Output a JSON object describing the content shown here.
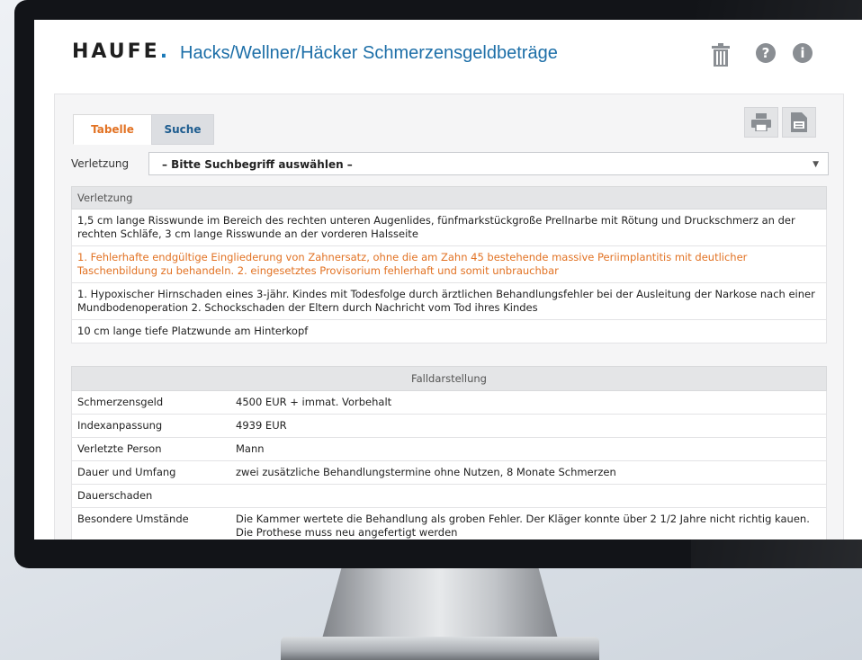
{
  "app": {
    "logo": "HAUFE",
    "logo_dot": ".",
    "title": "Hacks/Wellner/Häcker Schmerzensgeldbeträge",
    "header_icons": [
      "trash-icon",
      "help-icon",
      "info-icon"
    ],
    "help_glyph": "?",
    "info_glyph": "i"
  },
  "tabs": [
    {
      "label": "Tabelle",
      "active": true
    },
    {
      "label": "Suche",
      "active": false
    }
  ],
  "toolbar": {
    "icons": [
      "print-icon",
      "export-icon"
    ]
  },
  "filter": {
    "label": "Verletzung",
    "selected": "– Bitte Suchbegriff auswählen –"
  },
  "list": {
    "header": "Verletzung",
    "rows": [
      "1,5 cm lange Risswunde im Bereich des rechten unteren Augenlides, fünfmarkstückgroße Prellnarbe mit Rötung und Druckschmerz an der rechten Schläfe, 3 cm lange Risswunde an der vorderen Halsseite",
      "1. Fehlerhafte endgültige Eingliederung von Zahnersatz, ohne die am Zahn 45 bestehende massive Periimplantitis mit deutlicher Taschenbildung zu behandeln. 2. eingesetztes Provisorium fehlerhaft und somit unbrauchbar",
      "1. Hypoxischer Hirnschaden eines 3-jähr. Kindes mit Todesfolge durch ärztlichen Behandlungsfehler bei der Ausleitung der Narkose nach einer Mundbodenoperation 2. Schockschaden der Eltern durch Nachricht vom Tod ihres Kindes",
      "10 cm lange tiefe Platzwunde am Hinterkopf"
    ]
  },
  "details": {
    "header": "Falldarstellung",
    "rows": [
      {
        "key": "Schmerzensgeld",
        "value": "4500 EUR + immat. Vorbehalt"
      },
      {
        "key": "Indexanpassung",
        "value": "4939 EUR"
      },
      {
        "key": "Verletzte Person",
        "value": "Mann"
      },
      {
        "key": "Dauer und Umfang",
        "value": "zwei zusätzliche Behandlungstermine ohne Nutzen, 8 Monate Schmerzen"
      },
      {
        "key": "Dauerschaden",
        "value": ""
      },
      {
        "key": "Besondere Umstände",
        "value": "Die Kammer wertete die Behandlung als groben Fehler. Der Kläger konnte über 2 1/2 Jahre nicht richtig kauen. Die Prothese muss neu angefertigt werden"
      }
    ]
  },
  "colors": {
    "accent_orange": "#e27223",
    "brand_blue": "#1d6fa8",
    "icon_grey": "#8a8e93"
  }
}
